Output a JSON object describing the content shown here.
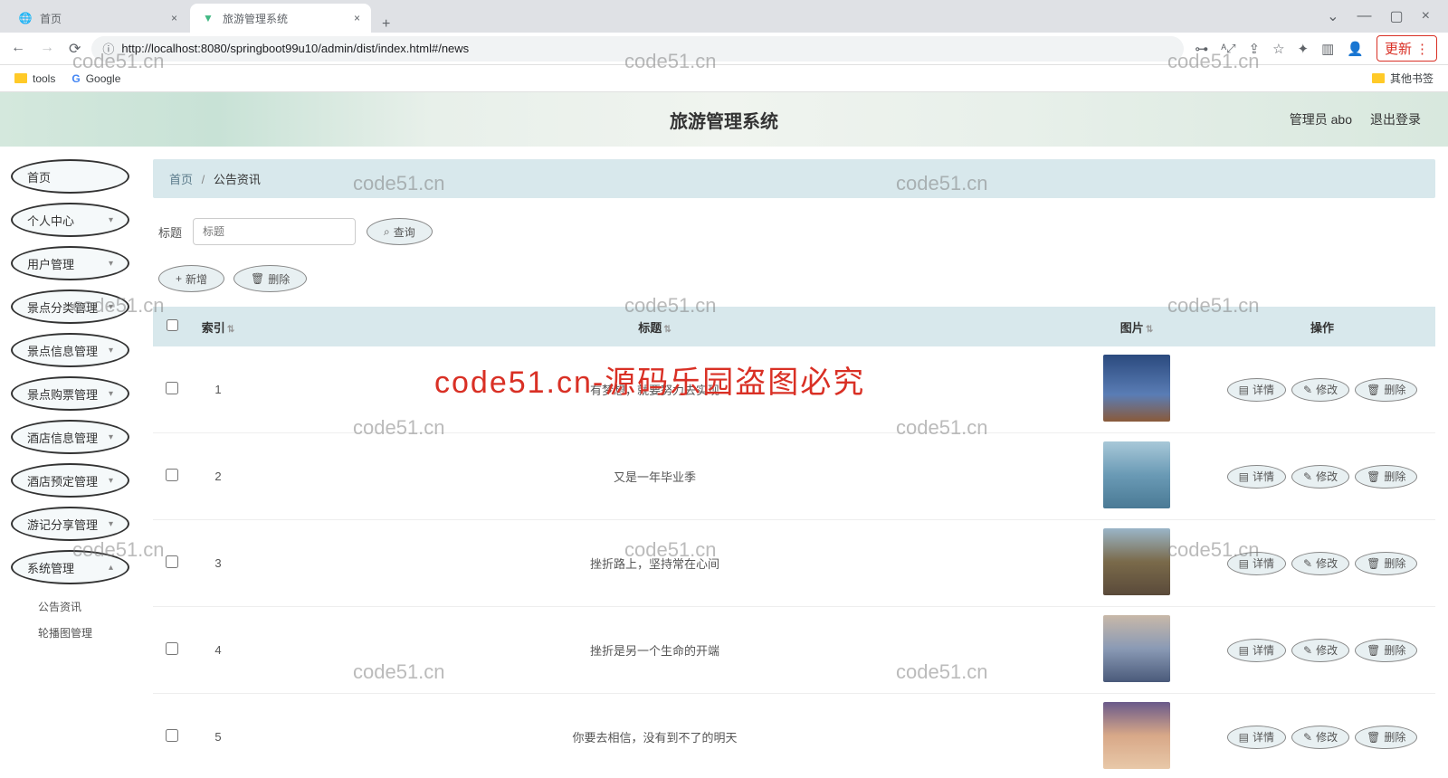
{
  "browser": {
    "tabs": [
      {
        "label": "首页",
        "active": false
      },
      {
        "label": "旅游管理系统",
        "active": true
      }
    ],
    "url": "http://localhost:8080/springboot99u10/admin/dist/index.html#/news",
    "update_label": "更新",
    "bookmarks": {
      "tools": "tools",
      "google": "Google",
      "other": "其他书签"
    }
  },
  "header": {
    "title": "旅游管理系统",
    "user": "管理员 abo",
    "logout": "退出登录"
  },
  "sidebar": {
    "items": [
      {
        "label": "首页",
        "expandable": false
      },
      {
        "label": "个人中心",
        "expandable": true
      },
      {
        "label": "用户管理",
        "expandable": true
      },
      {
        "label": "景点分类管理",
        "expandable": true
      },
      {
        "label": "景点信息管理",
        "expandable": true
      },
      {
        "label": "景点购票管理",
        "expandable": true
      },
      {
        "label": "酒店信息管理",
        "expandable": true
      },
      {
        "label": "酒店预定管理",
        "expandable": true
      },
      {
        "label": "游记分享管理",
        "expandable": true
      },
      {
        "label": "系统管理",
        "expandable": true
      }
    ],
    "sub_items": [
      "公告资讯",
      "轮播图管理"
    ]
  },
  "breadcrumb": {
    "home": "首页",
    "sep": "/",
    "current": "公告资讯"
  },
  "search": {
    "label": "标题",
    "placeholder": "标题",
    "query_btn": "查询"
  },
  "toolbar": {
    "add": "新增",
    "delete": "删除"
  },
  "table": {
    "headers": {
      "index": "索引",
      "title": "标题",
      "image": "图片",
      "ops": "操作"
    },
    "rows": [
      {
        "idx": "1",
        "title": "有梦想，就要努力去实现"
      },
      {
        "idx": "2",
        "title": "又是一年毕业季"
      },
      {
        "idx": "3",
        "title": "挫折路上，坚持常在心间"
      },
      {
        "idx": "4",
        "title": "挫折是另一个生命的开端"
      },
      {
        "idx": "5",
        "title": "你要去相信，没有到不了的明天"
      }
    ],
    "ops": {
      "detail": "详情",
      "edit": "修改",
      "delete": "删除"
    }
  },
  "watermarks": {
    "gray": "code51.cn",
    "red": "code51.cn-源码乐园盗图必究"
  }
}
